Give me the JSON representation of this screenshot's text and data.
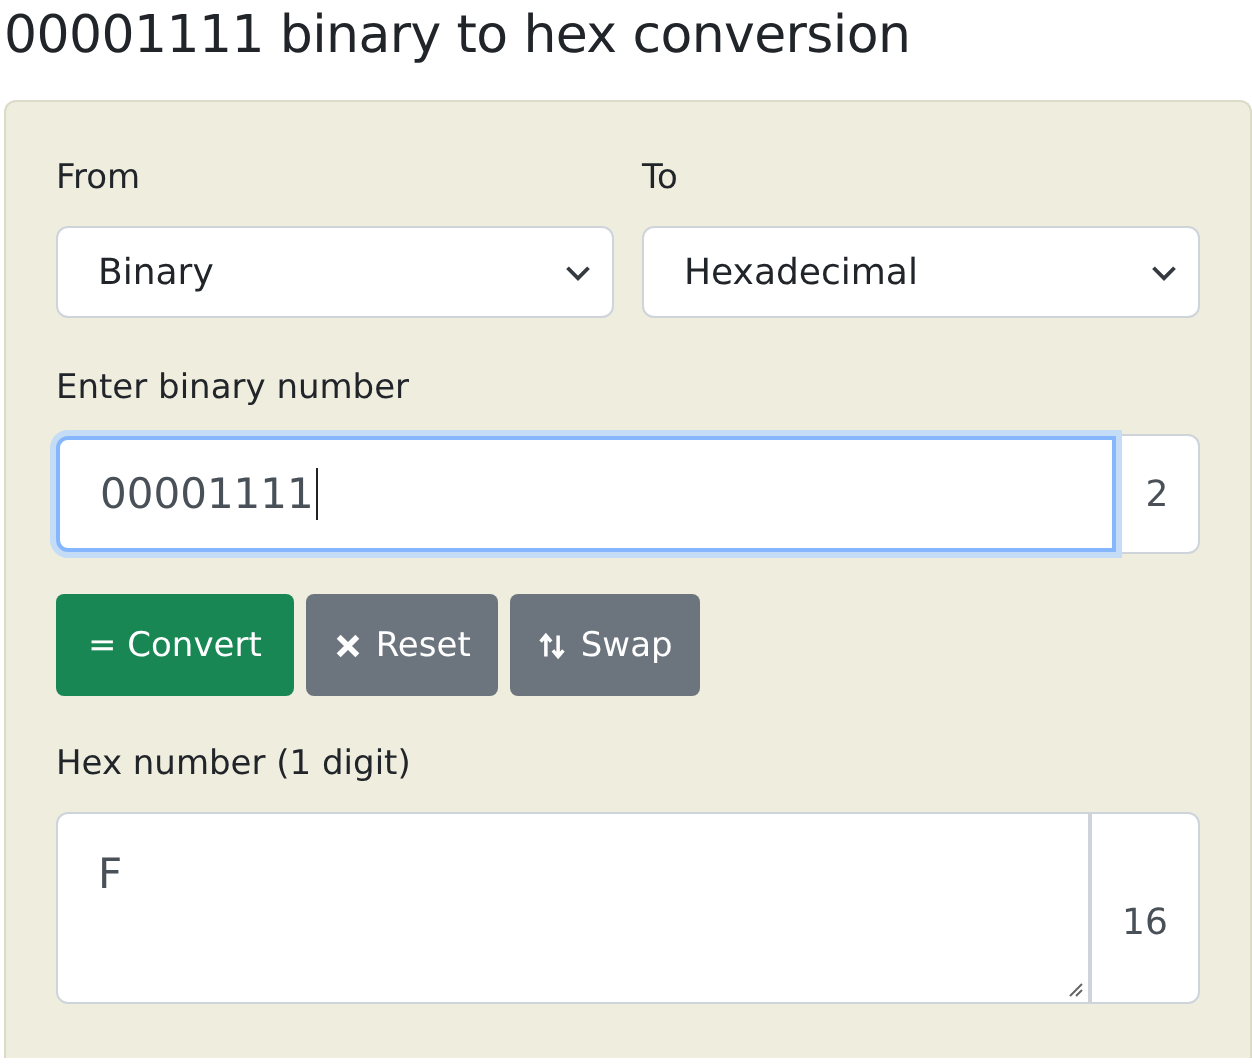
{
  "title": "00001111 binary to hex conversion",
  "from": {
    "label": "From",
    "value": "Binary"
  },
  "to": {
    "label": "To",
    "value": "Hexadecimal"
  },
  "input": {
    "label": "Enter binary number",
    "value": "00001111",
    "base": "2",
    "focused": true
  },
  "buttons": [
    {
      "kind": "convert",
      "label": "= Convert"
    },
    {
      "kind": "reset",
      "label": "Reset"
    },
    {
      "kind": "swap",
      "label": "Swap"
    }
  ],
  "output": {
    "label": "Hex number (1 digit)",
    "value": "F",
    "base": "16"
  }
}
